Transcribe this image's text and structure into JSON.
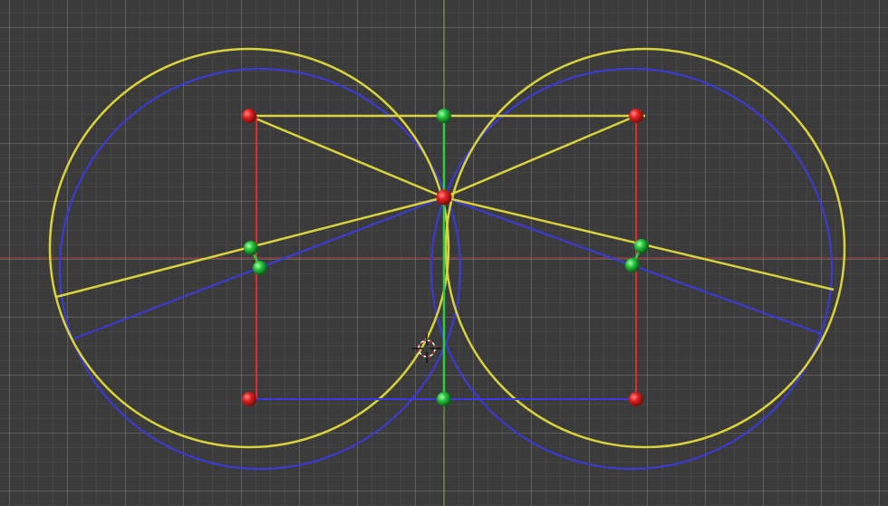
{
  "viewport": {
    "colors": {
      "background": "#3b3b3b",
      "x_axis": "#b04040",
      "y_axis": "#7fb23a",
      "yellow": "#d8d23c",
      "blue": "#3a3ae0",
      "red_line": "#dd2e2e",
      "green_line": "#2ecc40",
      "red_vertex": "#e02020",
      "green_vertex": "#22c23a"
    }
  }
}
